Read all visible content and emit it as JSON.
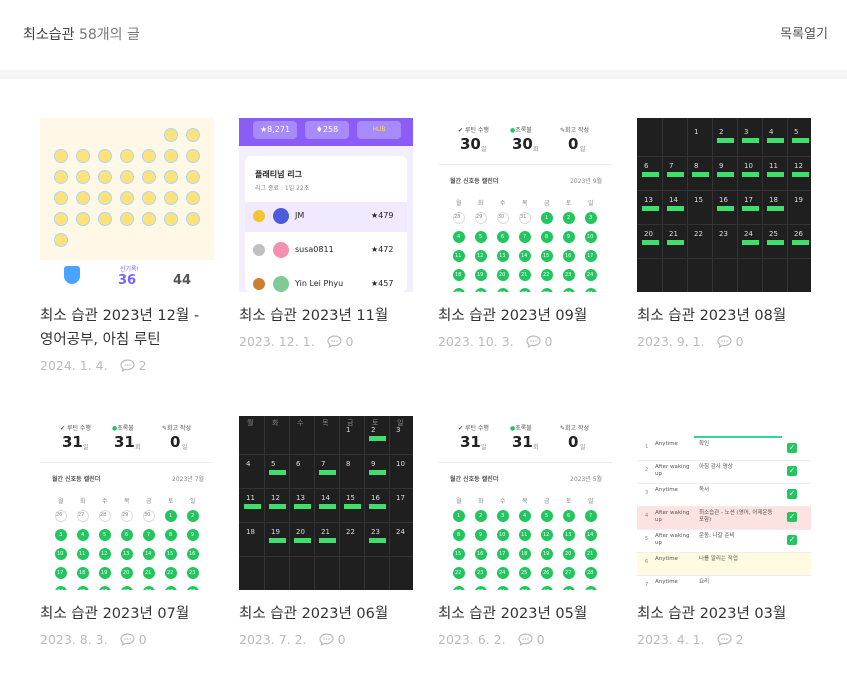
{
  "header": {
    "category": "최소습관",
    "count_text": "58개의 글",
    "toggle_label": "목록열기"
  },
  "posts": [
    {
      "title": "최소 습관 2023년 12월 - 영어공부, 아침 루틴",
      "date": "2024. 1. 4.",
      "comments": "2",
      "thumb": "stars"
    },
    {
      "title": "최소 습관 2023년 11월",
      "date": "2023. 12. 1.",
      "comments": "0",
      "thumb": "league"
    },
    {
      "title": "최소 습관 2023년 09월",
      "date": "2023. 10. 3.",
      "comments": "0",
      "thumb": "green"
    },
    {
      "title": "최소 습관 2023년 08월",
      "date": "2023. 9. 1.",
      "comments": "0",
      "thumb": "dark"
    },
    {
      "title": "최소 습관 2023년 07월",
      "date": "2023. 8. 3.",
      "comments": "0",
      "thumb": "green"
    },
    {
      "title": "최소 습관 2023년 06월",
      "date": "2023. 7. 2.",
      "comments": "0",
      "thumb": "dark"
    },
    {
      "title": "최소 습관 2023년 05월",
      "date": "2023. 6. 2.",
      "comments": "0",
      "thumb": "green"
    },
    {
      "title": "최소 습관 2023년 03월",
      "date": "2023. 4. 1.",
      "comments": "2",
      "thumb": "table"
    }
  ],
  "thumbs": {
    "stars": {
      "label": "신기록!",
      "value_a": "36",
      "value_b": "44"
    },
    "league": {
      "points": "8,271",
      "gems": "258",
      "badge": "HUB",
      "league_title": "플래티넘 리그",
      "league_sub": "리그 종료 : 1일 22초",
      "rows": [
        {
          "name": "JM",
          "score": "479"
        },
        {
          "name": "susa0811",
          "score": "472"
        },
        {
          "name": "Yin Lei Phyu",
          "score": "457"
        }
      ]
    },
    "green_09": {
      "s1_label": "루틴 수행",
      "s1_value": "30",
      "s1_unit": "일",
      "s2_label": "조록불",
      "s2_value": "30",
      "s2_unit": "회",
      "s3_label": "회고 작성",
      "s3_value": "0",
      "s3_unit": "일",
      "cal_title": "월간 신호등 캘린더",
      "cal_month": "2023년 9월"
    },
    "green_07": {
      "s1_label": "루틴 수행",
      "s1_value": "31",
      "s1_unit": "일",
      "s2_label": "초록불",
      "s2_value": "31",
      "s2_unit": "회",
      "s3_label": "회고 작성",
      "s3_value": "0",
      "s3_unit": "일",
      "cal_title": "월간 신호등 캘린더",
      "cal_month": "2023년 7월"
    },
    "green_05": {
      "s1_label": "루틴 수행",
      "s1_value": "31",
      "s1_unit": "일",
      "s2_label": "초록불",
      "s2_value": "31",
      "s2_unit": "회",
      "s3_label": "회고 작성",
      "s3_value": "0",
      "s3_unit": "일",
      "cal_title": "월간 신호등 캘린더",
      "cal_month": "2023년 5월"
    },
    "weekdays": [
      "월",
      "화",
      "수",
      "목",
      "금",
      "토",
      "일"
    ],
    "table": {
      "rows": [
        {
          "n": "1",
          "when": "Anytime",
          "task": "확인"
        },
        {
          "n": "2",
          "when": "After waking up",
          "task": "아침 감사 명상"
        },
        {
          "n": "3",
          "when": "Anytime",
          "task": "독서"
        },
        {
          "n": "4",
          "when": "After waking up",
          "task": "최소습관 - 노션 (영어, 어제운동 포함)"
        },
        {
          "n": "5",
          "when": "After waking up",
          "task": "운동, 나갈 준비"
        },
        {
          "n": "6",
          "when": "Anytime",
          "task": "나를 알리는 작업"
        },
        {
          "n": "7",
          "when": "Anytime",
          "task": "요리"
        }
      ]
    }
  }
}
